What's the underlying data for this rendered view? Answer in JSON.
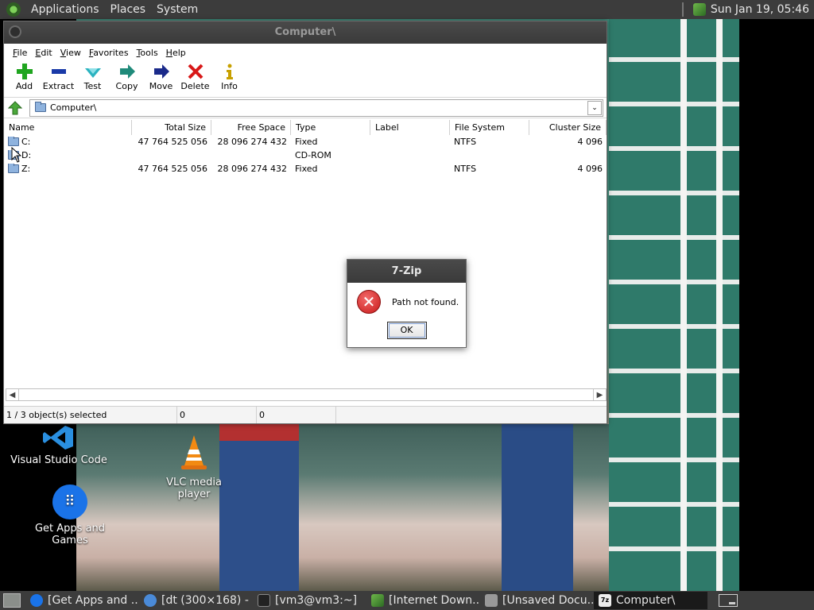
{
  "top_panel": {
    "menus": [
      "Applications",
      "Places",
      "System"
    ],
    "clock": "Sun Jan 19, 05:46"
  },
  "desktop_icons": [
    {
      "label": "Visual Studio Code",
      "icon": "vscode-icon"
    },
    {
      "label": "VLC media player",
      "icon": "vlc-icon"
    },
    {
      "label": "Get Apps and Games",
      "icon": "apps-grid-icon"
    }
  ],
  "window": {
    "title": "Computer\\",
    "menu": [
      "File",
      "Edit",
      "View",
      "Favorites",
      "Tools",
      "Help"
    ],
    "toolbar": [
      {
        "label": "Add",
        "icon": "plus-icon",
        "color": "#1fa51f"
      },
      {
        "label": "Extract",
        "icon": "minus-icon",
        "color": "#1a3aa8"
      },
      {
        "label": "Test",
        "icon": "check-icon",
        "color": "#2bb3c0"
      },
      {
        "label": "Copy",
        "icon": "copy-arrow-icon",
        "color": "#1f8a7a"
      },
      {
        "label": "Move",
        "icon": "move-arrow-icon",
        "color": "#1a2a8a"
      },
      {
        "label": "Delete",
        "icon": "delete-x-icon",
        "color": "#d81818"
      },
      {
        "label": "Info",
        "icon": "info-icon",
        "color": "#c8a000"
      }
    ],
    "address": "Computer\\",
    "columns": [
      "Name",
      "Total Size",
      "Free Space",
      "Type",
      "Label",
      "File System",
      "Cluster Size"
    ],
    "rows": [
      {
        "name": "C:",
        "total": "47 764 525 056",
        "free": "28 096 274 432",
        "type": "Fixed",
        "label": "",
        "fs": "NTFS",
        "cluster": "4 096"
      },
      {
        "name": "D:",
        "total": "",
        "free": "",
        "type": "CD-ROM",
        "label": "",
        "fs": "",
        "cluster": ""
      },
      {
        "name": "Z:",
        "total": "47 764 525 056",
        "free": "28 096 274 432",
        "type": "Fixed",
        "label": "",
        "fs": "NTFS",
        "cluster": "4 096"
      }
    ],
    "status": {
      "selected": "1 / 3 object(s) selected",
      "size": "0",
      "packed": "0"
    }
  },
  "dialog": {
    "title": "7-Zip",
    "message": "Path not found.",
    "ok_label": "OK"
  },
  "taskbar": {
    "tasks": [
      {
        "label": "[Get Apps and ...",
        "active": false
      },
      {
        "label": "[dt (300×168) - ...",
        "active": false
      },
      {
        "label": "[vm3@vm3:~]",
        "active": false
      },
      {
        "label": "[Internet Down...",
        "active": false
      },
      {
        "label": "[Unsaved Docu...",
        "active": false
      },
      {
        "label": "Computer\\",
        "active": true
      }
    ]
  }
}
